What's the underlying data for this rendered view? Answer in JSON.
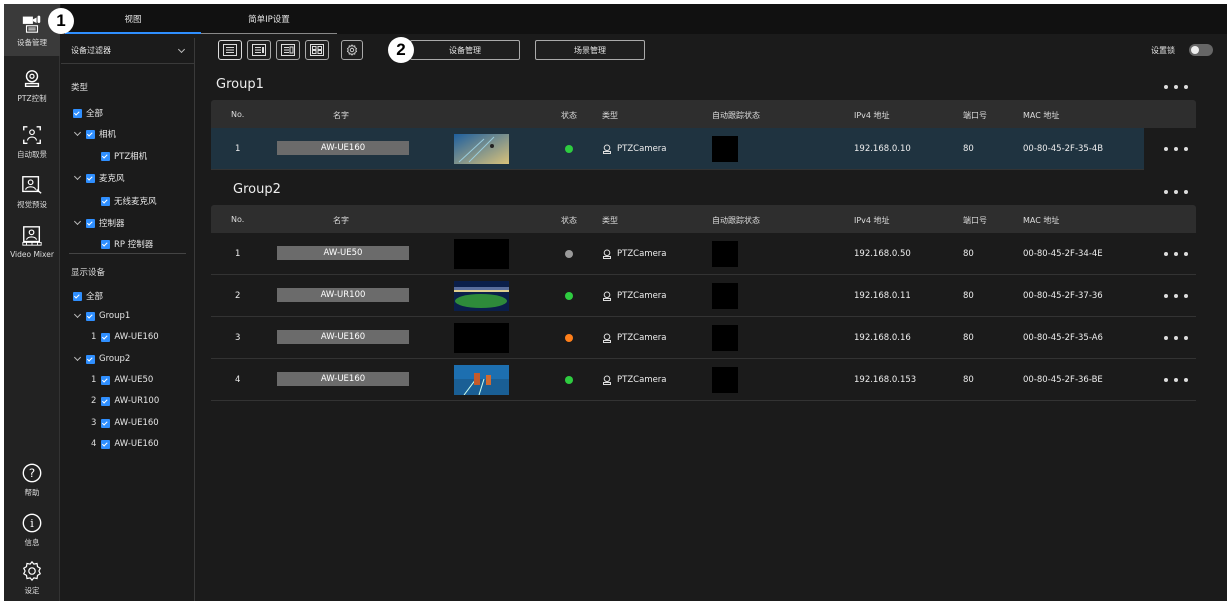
{
  "tabs": [
    {
      "label": "视图"
    },
    {
      "label": "简单IP设置"
    }
  ],
  "rail": [
    {
      "label": "设备管理",
      "icon": "camera-mic-icon"
    },
    {
      "label": "PTZ控制",
      "icon": "ptz-camera-icon"
    },
    {
      "label": "自动取景",
      "icon": "auto-framing-icon"
    },
    {
      "label": "视觉预设",
      "icon": "visual-preset-icon"
    },
    {
      "label": "Video Mixer",
      "icon": "video-mixer-icon"
    },
    {
      "label": "帮助",
      "icon": "help-icon"
    },
    {
      "label": "信息",
      "icon": "info-icon"
    },
    {
      "label": "设定",
      "icon": "gear-icon"
    }
  ],
  "filter": {
    "title": "设备过滤器",
    "type_section": "类型",
    "type_items": [
      "全部",
      "相机",
      "PTZ相机",
      "麦克风",
      "无线麦克风",
      "控制器",
      "RP 控制器"
    ],
    "display_section": "显示设备",
    "display_all": "全部",
    "groups": [
      {
        "name": "Group1",
        "items": [
          {
            "n": "1",
            "name": "AW-UE160"
          }
        ]
      },
      {
        "name": "Group2",
        "items": [
          {
            "n": "1",
            "name": "AW-UE50"
          },
          {
            "n": "2",
            "name": "AW-UR100"
          },
          {
            "n": "3",
            "name": "AW-UE160"
          },
          {
            "n": "4",
            "name": "AW-UE160"
          }
        ]
      }
    ]
  },
  "toolbar": {
    "device_mgmt": "设备管理",
    "scene_mgmt": "场景管理",
    "lock_label": "设置锁"
  },
  "callouts": [
    "1",
    "2"
  ],
  "columns": [
    "No.",
    "名字",
    "状态",
    "类型",
    "自动跟踪状态",
    "IPv4 地址",
    "端口号",
    "MAC 地址"
  ],
  "colors": {
    "accent": "#2f8fff",
    "status_green": "#2ecc40",
    "status_gray": "#9a9a9a",
    "status_orange": "#ff7f1a"
  },
  "groups": [
    {
      "name": "Group1",
      "rows": [
        {
          "no": "1",
          "name": "AW-UE160",
          "status": "green",
          "type": "PTZCamera",
          "ip": "192.168.0.10",
          "port": "80",
          "mac": "00-80-45-2F-35-4B",
          "thumb": "concert"
        }
      ]
    },
    {
      "name": "Group2",
      "rows": [
        {
          "no": "1",
          "name": "AW-UE50",
          "status": "gray",
          "type": "PTZCamera",
          "ip": "192.168.0.50",
          "port": "80",
          "mac": "00-80-45-2F-34-4E",
          "thumb": "black"
        },
        {
          "no": "2",
          "name": "AW-UR100",
          "status": "green",
          "type": "PTZCamera",
          "ip": "192.168.0.11",
          "port": "80",
          "mac": "00-80-45-2F-37-36",
          "thumb": "stadium"
        },
        {
          "no": "3",
          "name": "AW-UE160",
          "status": "orange",
          "type": "PTZCamera",
          "ip": "192.168.0.16",
          "port": "80",
          "mac": "00-80-45-2F-35-A6",
          "thumb": "black"
        },
        {
          "no": "4",
          "name": "AW-UE160",
          "status": "green",
          "type": "PTZCamera",
          "ip": "192.168.0.153",
          "port": "80",
          "mac": "00-80-45-2F-36-BE",
          "thumb": "track"
        }
      ]
    }
  ]
}
